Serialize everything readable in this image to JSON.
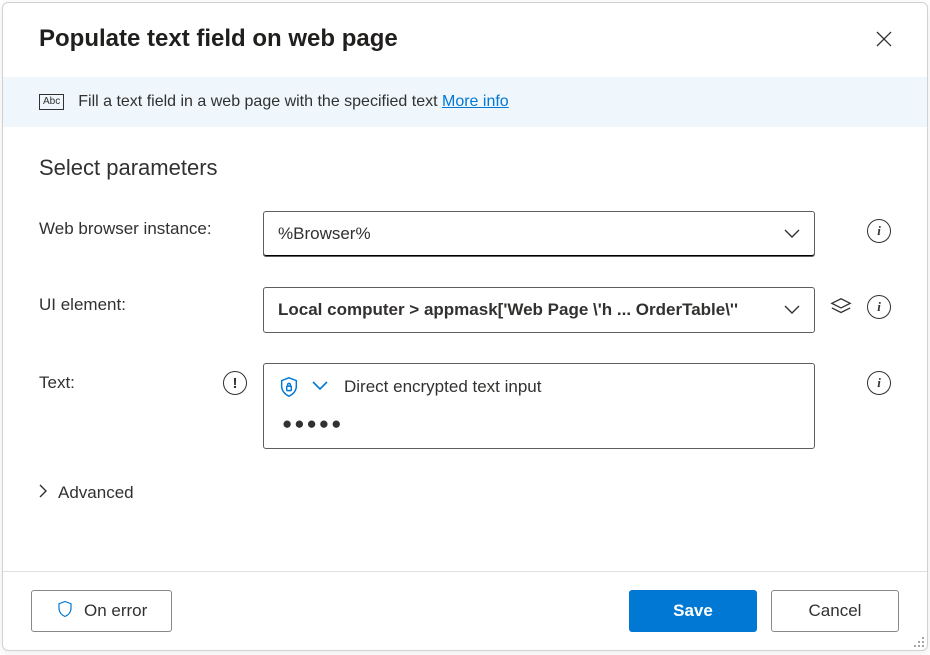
{
  "header": {
    "title": "Populate text field on web page"
  },
  "banner": {
    "icon_text": "Abc",
    "description": "Fill a text field in a web page with the specified text ",
    "more_info": "More info"
  },
  "section": {
    "title": "Select parameters"
  },
  "fields": {
    "browser": {
      "label": "Web browser instance:",
      "value": "%Browser%"
    },
    "ui_element": {
      "label": "UI element:",
      "value": "Local computer > appmask['Web Page \\'h ... OrderTable\\''"
    },
    "text": {
      "label": "Text:",
      "mode_label": "Direct encrypted text input",
      "masked_value": "●●●●●"
    },
    "advanced": {
      "label": "Advanced"
    }
  },
  "footer": {
    "on_error": "On error",
    "save": "Save",
    "cancel": "Cancel"
  }
}
